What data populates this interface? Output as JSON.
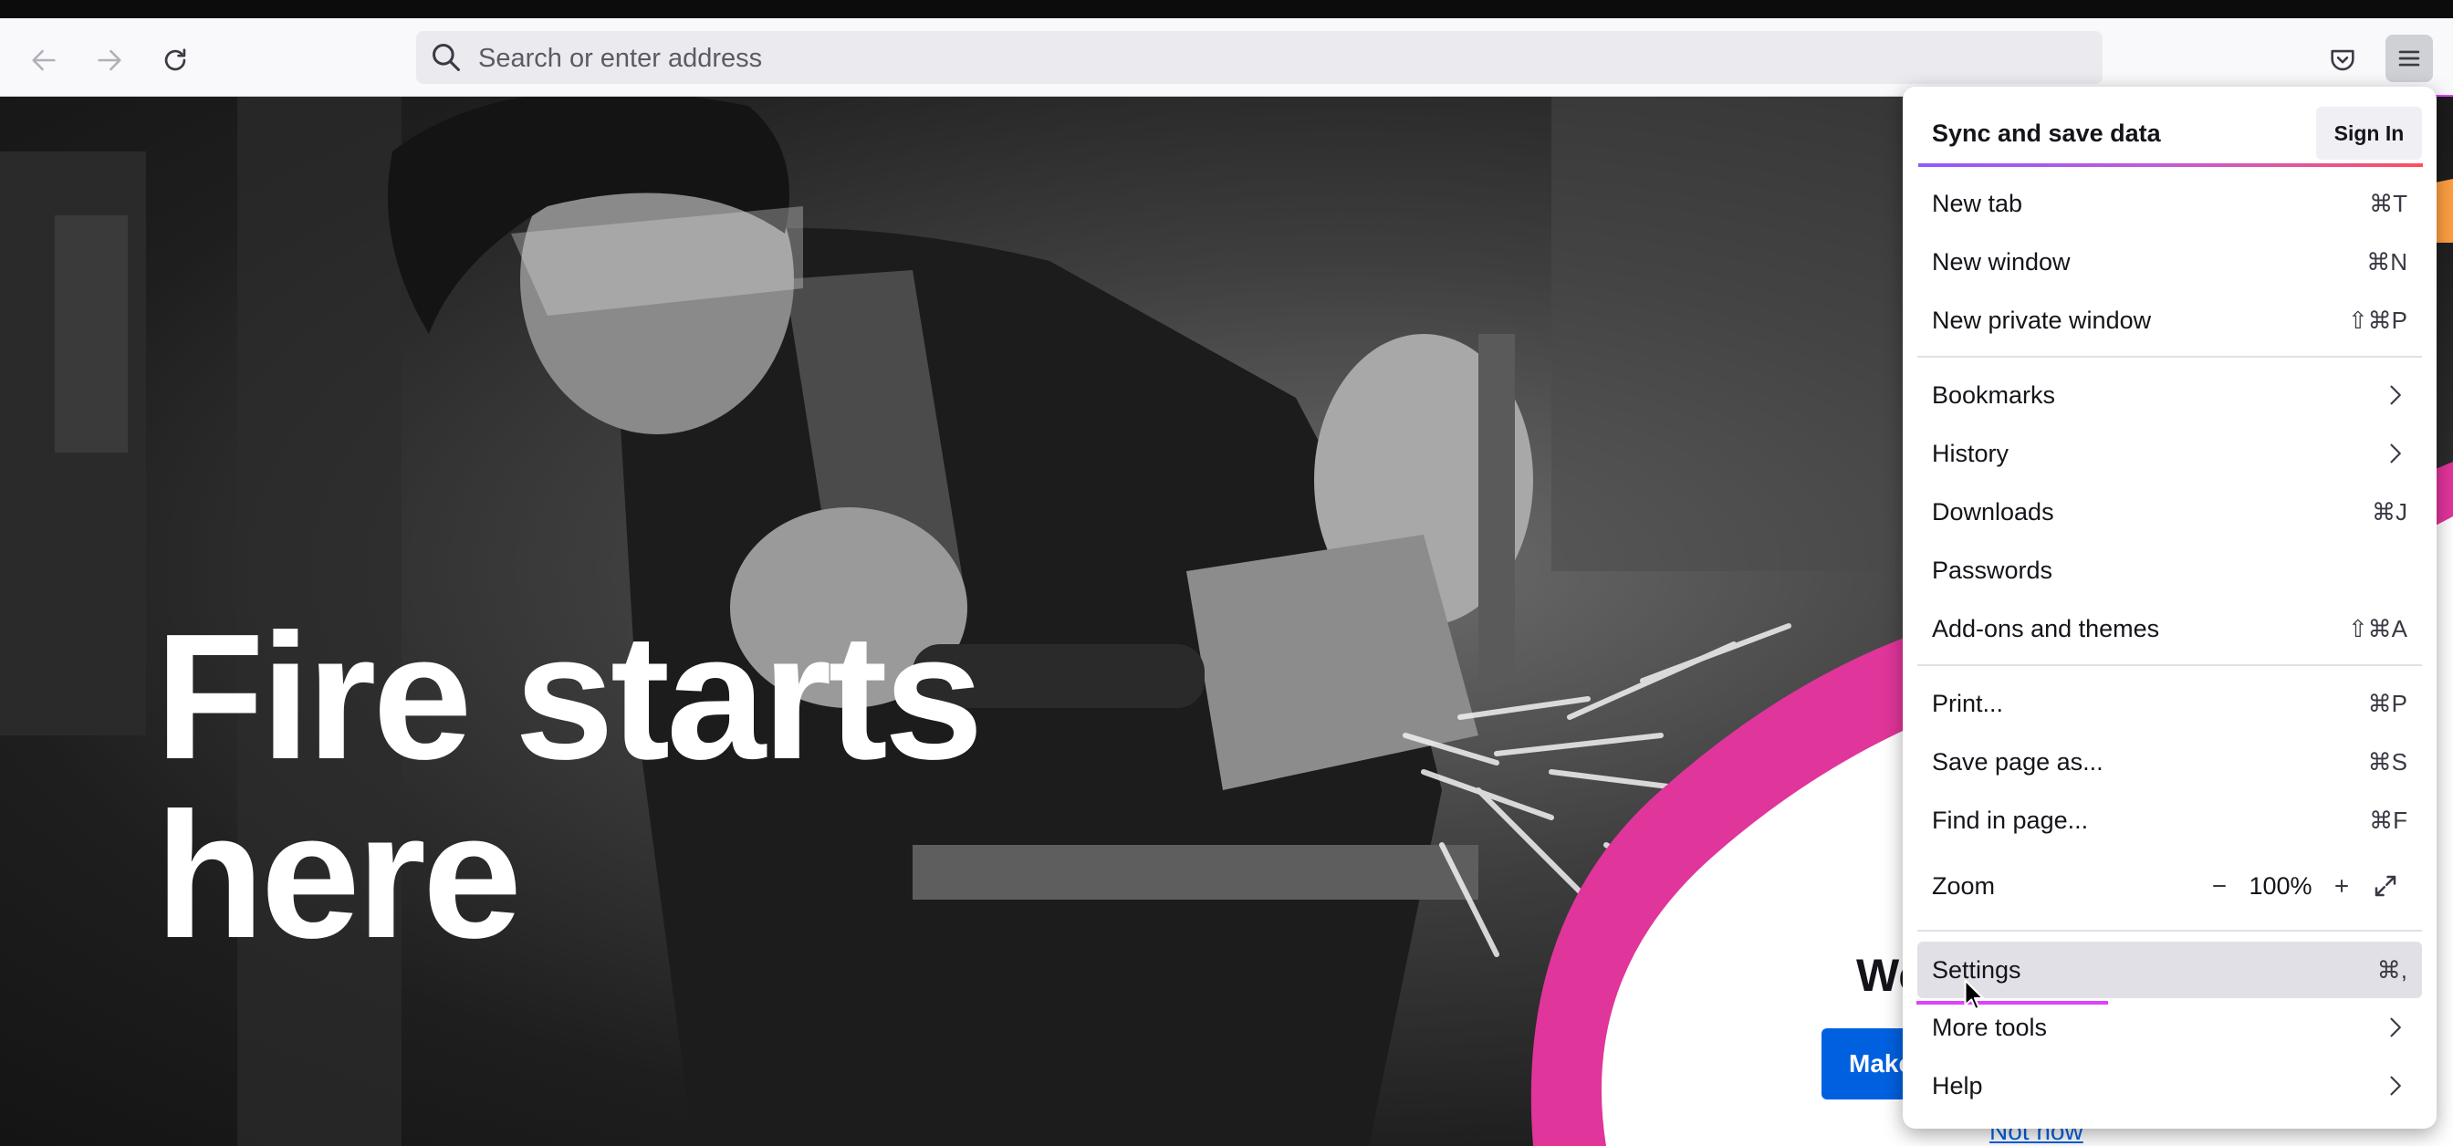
{
  "toolbar": {
    "back_icon": "arrow-left-icon",
    "forward_icon": "arrow-right-icon",
    "reload_icon": "reload-icon",
    "pocket_icon": "pocket-icon",
    "menu_icon": "hamburger-menu-icon",
    "search_placeholder": "Search or enter address"
  },
  "page": {
    "headline_line1": "Fire starts",
    "headline_line2": "here",
    "peek_heading": "We",
    "peek_button": "Make",
    "peek_link": "Not now"
  },
  "app_menu": {
    "sync_title": "Sync and save data",
    "sign_in": "Sign In",
    "items": [
      {
        "label": "New tab",
        "shortcut": "⌘T"
      },
      {
        "label": "New window",
        "shortcut": "⌘N"
      },
      {
        "label": "New private window",
        "shortcut": "⇧⌘P"
      },
      {
        "label": "Bookmarks",
        "submenu": true
      },
      {
        "label": "History",
        "submenu": true
      },
      {
        "label": "Downloads",
        "shortcut": "⌘J"
      },
      {
        "label": "Passwords",
        "shortcut": ""
      },
      {
        "label": "Add-ons and themes",
        "shortcut": "⇧⌘A"
      },
      {
        "label": "Print...",
        "shortcut": "⌘P"
      },
      {
        "label": "Save page as...",
        "shortcut": "⌘S"
      },
      {
        "label": "Find in page...",
        "shortcut": "⌘F"
      },
      {
        "label": "Settings",
        "shortcut": "⌘,",
        "hovered": true
      },
      {
        "label": "More tools",
        "submenu": true
      },
      {
        "label": "Help",
        "submenu": true
      }
    ],
    "zoom": {
      "label": "Zoom",
      "value": "100%",
      "minus": "−",
      "plus": "+",
      "fullscreen_icon": "fullscreen-icon"
    }
  },
  "colors": {
    "accent_blue": "#0061e0",
    "pink": "#e0359a",
    "highlight_magenta": "#e040fb"
  }
}
